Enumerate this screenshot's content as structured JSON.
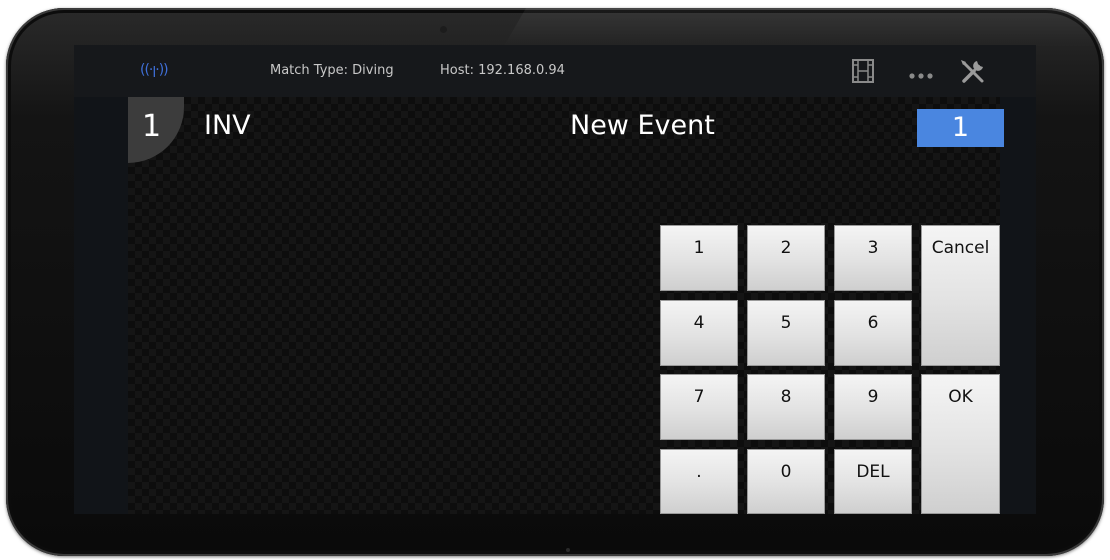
{
  "status_bar": {
    "wifi_icon": "((·ꞁ·))",
    "match_type": "Match Type: Diving",
    "host": "Host: 192.168.0.94",
    "icons": [
      "film-icon",
      "more-icon",
      "tools-icon"
    ]
  },
  "header": {
    "lane_number": "1",
    "abbreviation": "INV",
    "event_title": "New Event",
    "counter": "1"
  },
  "keypad": {
    "k1": "1",
    "k2": "2",
    "k3": "3",
    "k4": "4",
    "k5": "5",
    "k6": "6",
    "k7": "7",
    "k8": "8",
    "k9": "9",
    "kdot": ".",
    "k0": "0",
    "kdel": "DEL",
    "cancel": "Cancel",
    "ok": "OK"
  },
  "colors": {
    "accent": "#4a86e0",
    "wifi": "#3f6fd8",
    "background": "#000000"
  }
}
